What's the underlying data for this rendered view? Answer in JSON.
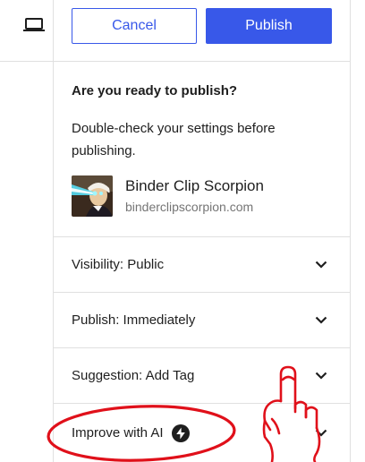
{
  "header": {
    "cancel_label": "Cancel",
    "publish_label": "Publish"
  },
  "prepublish": {
    "title": "Are you ready to publish?",
    "description": "Double-check your settings before publishing."
  },
  "site": {
    "name": "Binder Clip Scorpion",
    "url": "binderclipscorpion.com"
  },
  "panels": [
    {
      "label": "Visibility: Public"
    },
    {
      "label": "Publish: Immediately"
    },
    {
      "label": "Suggestion: Add Tag"
    },
    {
      "label": "Improve with AI",
      "icon": "jetpack-bolt-icon"
    }
  ],
  "colors": {
    "accent": "#3858e9",
    "annotation": "#e0101a",
    "border": "#e0e0e0"
  },
  "icons": {
    "device": "laptop-icon",
    "chevron": "chevron-down-icon"
  }
}
